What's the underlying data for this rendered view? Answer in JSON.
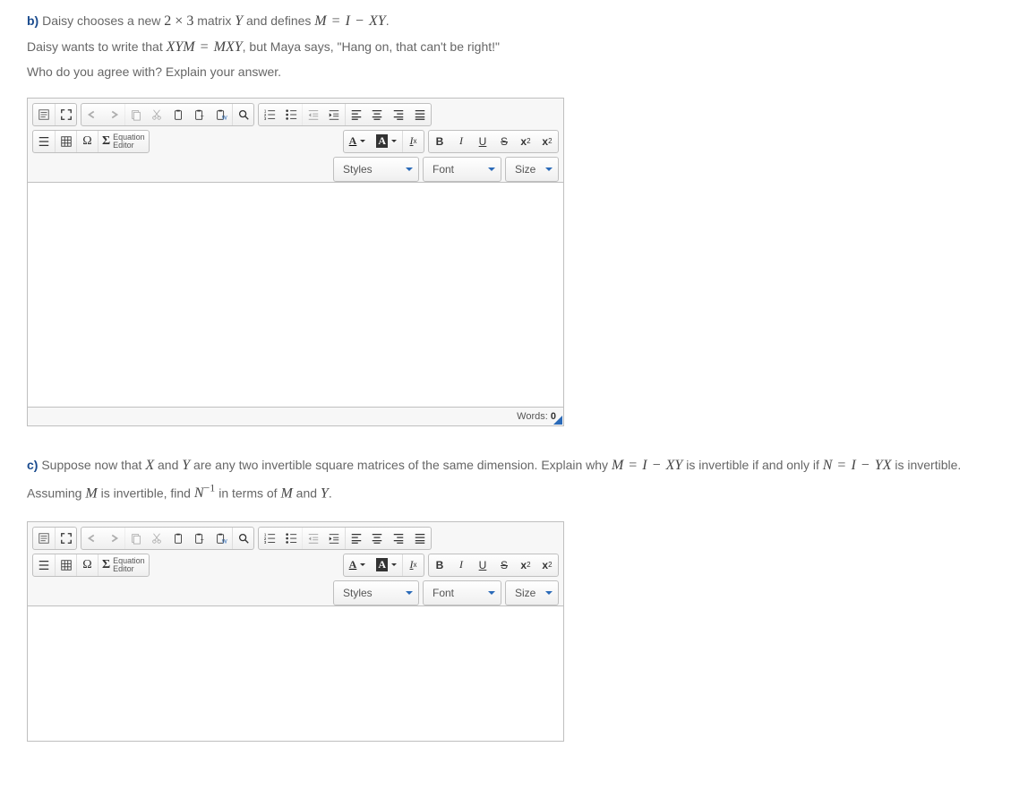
{
  "questions": {
    "b": {
      "label": "b)",
      "line1_pre": " Daisy chooses a new ",
      "dim": "2 × 3",
      "line1_mid": " matrix ",
      "varY": "Y",
      "line1_def": " and defines ",
      "eq1": "M = I − XY",
      "line1_end": ".",
      "line2_pre": "Daisy wants to write that ",
      "eq2": "XYM = MXY",
      "line2_post": ", but Maya says, \"Hang on, that can't be right!\"",
      "line3": "Who do you agree with? Explain your answer."
    },
    "c": {
      "label": "c)",
      "line1_pre": " Suppose now that ",
      "varX": "X",
      "and1": " and ",
      "varY": "Y",
      "line1_mid": " are any two invertible square matrices of the same dimension. Explain why ",
      "eq1": "M = I − XY",
      "line1_mid2": " is invertible if and only if ",
      "eq2": "N = I − YX",
      "line1_end": " is invertible.",
      "line2_pre": "Assuming ",
      "varM": "M",
      "line2_mid": " is invertible, find ",
      "Ninv_base": "N",
      "Ninv_exp": "−1",
      "line2_mid2": " in terms of ",
      "varM2": "M",
      "and2": " and ",
      "varY2": "Y",
      "line2_end": "."
    }
  },
  "editor": {
    "eq_label_1": "Equation",
    "eq_label_2": "Editor",
    "styles": "Styles",
    "font": "Font",
    "size": "Size",
    "words_label": "Words: ",
    "word_count": "0",
    "text_color_glyph": "A",
    "bg_color_glyph": "A",
    "remove_fmt_glyph": "I",
    "remove_fmt_sub": "x",
    "bold": "B",
    "italic": "I",
    "underline": "U",
    "strike": "S",
    "sub_glyph": "x",
    "sub_index": "2",
    "sup_glyph": "x",
    "sup_index": "2",
    "omega": "Ω",
    "sigma": "Σ"
  }
}
